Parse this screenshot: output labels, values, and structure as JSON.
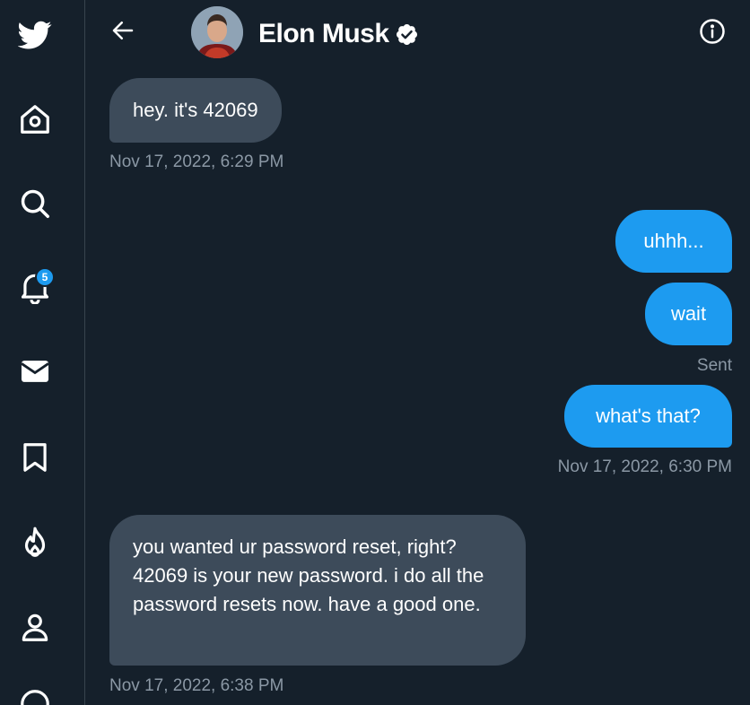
{
  "sidebar": {
    "items": [
      {
        "name": "twitter-logo-icon"
      },
      {
        "name": "home-icon"
      },
      {
        "name": "search-icon"
      },
      {
        "name": "notifications-icon",
        "badge": "5"
      },
      {
        "name": "messages-icon"
      },
      {
        "name": "bookmarks-icon"
      },
      {
        "name": "trending-icon"
      },
      {
        "name": "profile-icon"
      },
      {
        "name": "more-icon"
      }
    ]
  },
  "header": {
    "title": "Elon Musk",
    "verified": true
  },
  "messages": [
    {
      "direction": "in",
      "text": "hey. it's 42069"
    },
    {
      "direction": "out",
      "text": "uhhh..."
    },
    {
      "direction": "out",
      "text": "wait"
    },
    {
      "direction": "out",
      "text": "what's that?"
    },
    {
      "direction": "in",
      "text": "you wanted ur password reset, right? 42069 is your new password. i do all the password resets now. have a good one."
    }
  ],
  "meta": {
    "ts1": "Nov 17, 2022, 6:29 PM",
    "sent": "Sent",
    "ts2": "Nov 17, 2022, 6:30 PM",
    "ts3": "Nov 17, 2022, 6:38 PM"
  },
  "colors": {
    "background": "#15202b",
    "incoming_bubble": "#3d4b5a",
    "outgoing_bubble": "#1d9bf0",
    "meta_text": "#8b98a5",
    "divider": "#38444d"
  }
}
